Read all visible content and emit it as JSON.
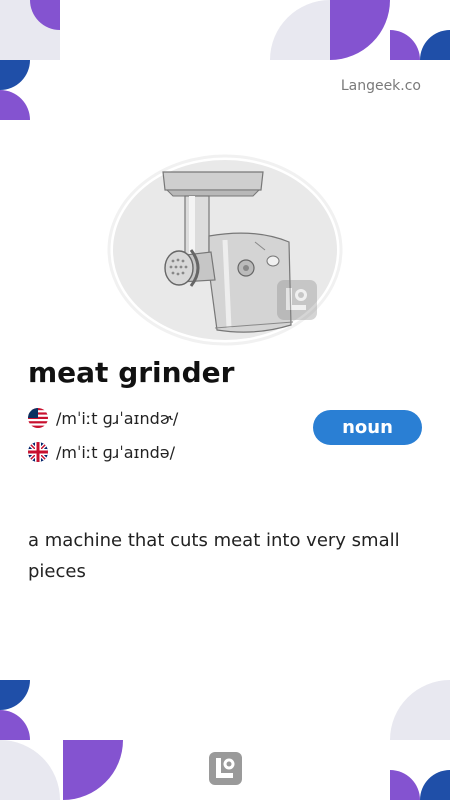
{
  "brand": {
    "site": "Langeek.co"
  },
  "word": {
    "headword": "meat grinder",
    "part_of_speech": "noun"
  },
  "pronunciations": [
    {
      "flag": "us-flag-icon",
      "ipa": "/mˈiːt ɡɹˈaɪndɚ/"
    },
    {
      "flag": "uk-flag-icon",
      "ipa": "/mˈiːt ɡɹˈaɪndə/"
    }
  ],
  "definition": {
    "text": "a machine that cuts meat into very small pieces"
  },
  "images": {
    "illustration": "meat-grinder-illustration",
    "footer_logo": "langeek-logo-icon"
  },
  "colors": {
    "accent_blue": "#2a7fd4",
    "purple": "#8453d0",
    "navy": "#1f4fa8",
    "light_gray": "#e8e8f0"
  }
}
